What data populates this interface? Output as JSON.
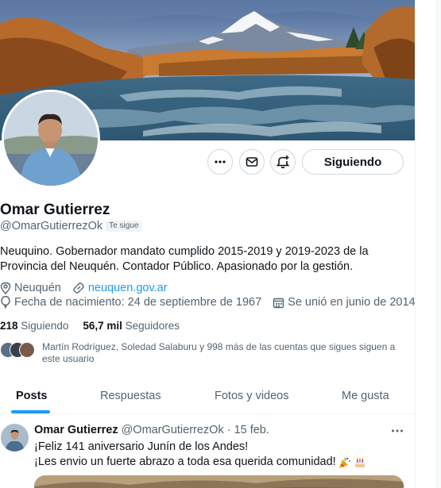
{
  "profile": {
    "name": "Omar Gutierrez",
    "handle": "@OmarGutierrezOk",
    "follows_you": "Te sigue",
    "bio": "Neuquino. Gobernador mandato cumplido 2015-2019 y 2019-2023 de la Provincia del Neuquén. Contador Público. Apasionado por la gestión.",
    "location": "Neuquén",
    "website": "neuquen.gov.ar",
    "birthday": "Fecha de nacimiento: 24 de septiembre de 1967",
    "joined": "Se unió en junio de 2014",
    "following_count": "218",
    "following_label": "Siguiendo",
    "followers_count": "56,7 mil",
    "followers_label": "Seguidores",
    "followed_by": "Martín Rodríguez, Soledad Salaburu y 998 más de las cuentas que sigues siguen a este usuario"
  },
  "actions": {
    "more_icon": "more-horizontal-icon",
    "message_icon": "mail-icon",
    "notify_icon": "bell-plus-icon",
    "follow_label": "Siguiendo"
  },
  "tabs": [
    {
      "label": "Posts",
      "active": true
    },
    {
      "label": "Respuestas",
      "active": false
    },
    {
      "label": "Fotos y videos",
      "active": false
    },
    {
      "label": "Me gusta",
      "active": false
    }
  ],
  "post": {
    "author": "Omar Gutierrez",
    "handle": "@OmarGutierrezOk",
    "separator": "·",
    "time": "15 feb.",
    "line1": "¡Feliz 141 aniversario Junín de los Andes!",
    "line2": "¡Les envio un fuerte abrazo a toda esa querida comunidad!",
    "emojis": [
      "party-popper-emoji",
      "birthday-cake-emoji"
    ]
  },
  "colors": {
    "accent": "#1d9bf0",
    "text": "#0f1419",
    "secondary": "#536471",
    "border": "#cfd9de"
  }
}
